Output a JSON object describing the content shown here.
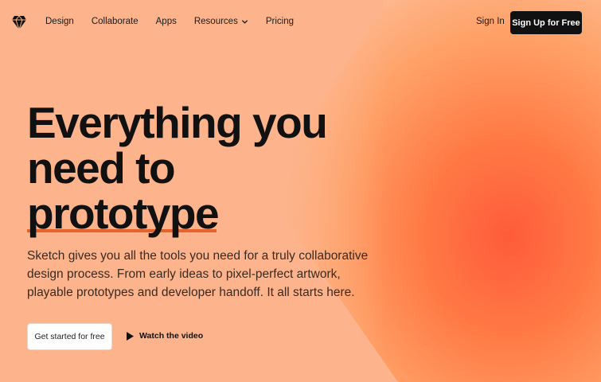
{
  "nav": {
    "logo_icon": "diamond-logo-icon",
    "links": [
      {
        "label": "Design"
      },
      {
        "label": "Collaborate"
      },
      {
        "label": "Apps"
      },
      {
        "label": "Resources",
        "has_dropdown": true
      },
      {
        "label": "Pricing"
      }
    ],
    "sign_in": "Sign In",
    "sign_up": "Sign Up for Free"
  },
  "hero": {
    "title_line1": "Everything you",
    "title_line2": "need to",
    "title_line3": "prototype",
    "description": "Sketch gives you all the tools you need for a truly collaborative design process. From early ideas to pixel-perfect artwork, playable prototypes and developer handoff. It all starts here.",
    "primary_cta": "Get started for free",
    "video_cta": "Watch the video"
  },
  "colors": {
    "background": "#fdb48c",
    "accent": "#e8622c",
    "button_dark": "#111111",
    "gradient_hot": "#ff6a3d"
  }
}
